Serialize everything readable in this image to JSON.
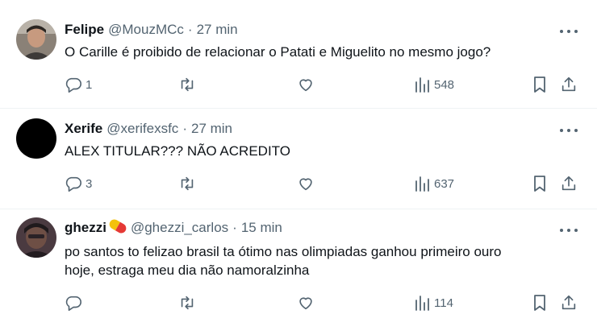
{
  "tweets": [
    {
      "name": "Felipe",
      "handle": "@MouzMCc",
      "separator": "·",
      "time": "27 min",
      "text": "O Carille é proibido de relacionar o Patati e Miguelito no mesmo jogo?",
      "replies": "1",
      "retweets": "",
      "likes": "",
      "views": "548"
    },
    {
      "name": "Xerife",
      "handle": "@xerifexsfc",
      "separator": "·",
      "time": "27 min",
      "text": "ALEX TITULAR??? NÃO ACREDITO",
      "replies": "3",
      "retweets": "",
      "likes": "",
      "views": "637"
    },
    {
      "name": "ghezzi",
      "name_emoji": "pill-emoji",
      "handle": "@ghezzi_carlos",
      "separator": "·",
      "time": "15 min",
      "text_line1": "po santos to felizao brasil ta ótimo nas olimpiadas ganhou primeiro ouro",
      "text_line2": "hoje, estraga meu dia não namoralzinha",
      "replies": "",
      "retweets": "",
      "likes": "",
      "views": "114"
    }
  ],
  "icons": {
    "reply": "reply-icon",
    "retweet": "retweet-icon",
    "like": "heart-icon",
    "views": "views-chart-icon",
    "bookmark": "bookmark-icon",
    "share": "share-icon",
    "more": "more-dots-icon"
  },
  "colors": {
    "text": "#0f1419",
    "secondary": "#536471",
    "divider": "#eff3f4",
    "background": "#ffffff"
  }
}
